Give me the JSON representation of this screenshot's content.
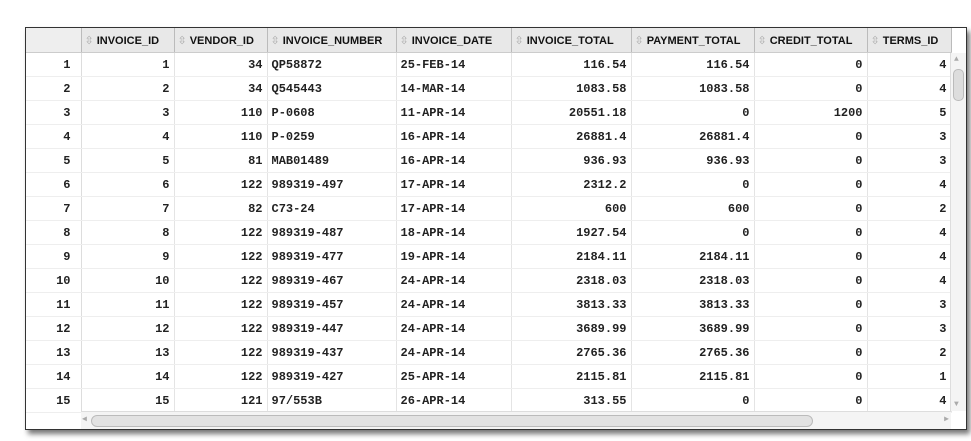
{
  "columns": [
    "INVOICE_ID",
    "VENDOR_ID",
    "INVOICE_NUMBER",
    "INVOICE_DATE",
    "INVOICE_TOTAL",
    "PAYMENT_TOTAL",
    "CREDIT_TOTAL",
    "TERMS_ID"
  ],
  "rows": [
    [
      "1",
      "1",
      "34",
      "QP58872",
      "25-FEB-14",
      "116.54",
      "116.54",
      "0",
      "4"
    ],
    [
      "2",
      "2",
      "34",
      "Q545443",
      "14-MAR-14",
      "1083.58",
      "1083.58",
      "0",
      "4"
    ],
    [
      "3",
      "3",
      "110",
      "P-0608",
      "11-APR-14",
      "20551.18",
      "0",
      "1200",
      "5"
    ],
    [
      "4",
      "4",
      "110",
      "P-0259",
      "16-APR-14",
      "26881.4",
      "26881.4",
      "0",
      "3"
    ],
    [
      "5",
      "5",
      "81",
      "MAB01489",
      "16-APR-14",
      "936.93",
      "936.93",
      "0",
      "3"
    ],
    [
      "6",
      "6",
      "122",
      "989319-497",
      "17-APR-14",
      "2312.2",
      "0",
      "0",
      "4"
    ],
    [
      "7",
      "7",
      "82",
      "C73-24",
      "17-APR-14",
      "600",
      "600",
      "0",
      "2"
    ],
    [
      "8",
      "8",
      "122",
      "989319-487",
      "18-APR-14",
      "1927.54",
      "0",
      "0",
      "4"
    ],
    [
      "9",
      "9",
      "122",
      "989319-477",
      "19-APR-14",
      "2184.11",
      "2184.11",
      "0",
      "4"
    ],
    [
      "10",
      "10",
      "122",
      "989319-467",
      "24-APR-14",
      "2318.03",
      "2318.03",
      "0",
      "4"
    ],
    [
      "11",
      "11",
      "122",
      "989319-457",
      "24-APR-14",
      "3813.33",
      "3813.33",
      "0",
      "3"
    ],
    [
      "12",
      "12",
      "122",
      "989319-447",
      "24-APR-14",
      "3689.99",
      "3689.99",
      "0",
      "3"
    ],
    [
      "13",
      "13",
      "122",
      "989319-437",
      "24-APR-14",
      "2765.36",
      "2765.36",
      "0",
      "2"
    ],
    [
      "14",
      "14",
      "122",
      "989319-427",
      "25-APR-14",
      "2115.81",
      "2115.81",
      "0",
      "1"
    ],
    [
      "15",
      "15",
      "121",
      "97/553B",
      "26-APR-14",
      "313.55",
      "0",
      "0",
      "4"
    ]
  ]
}
